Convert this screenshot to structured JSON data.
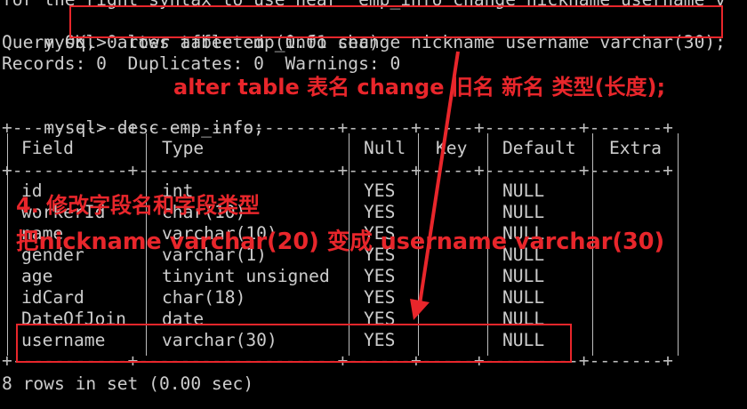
{
  "terminal": {
    "line0": "for the right syntax to use near 'emp_info change nickname username v",
    "prompt": "mysql>",
    "cmd1": "alter table emp_info change nickname username varchar(30);",
    "query_ok": "Query OK, 0 rows affected (0.01 sec)",
    "records": "Records: 0  Duplicates: 0  Warnings: 0",
    "cmd2": "desc emp_info;",
    "border": "+-----------+-------------------+------+-----+---------+-------+",
    "headers": [
      "Field",
      "Type",
      "Null",
      "Key",
      "Default",
      "Extra"
    ],
    "rows": [
      {
        "field": "id",
        "type": "int",
        "null": "YES",
        "key": "",
        "default": "NULL",
        "extra": ""
      },
      {
        "field": "workerId",
        "type": "char(10)",
        "null": "YES",
        "key": "",
        "default": "NULL",
        "extra": ""
      },
      {
        "field": "name",
        "type": "varchar(10)",
        "null": "YES",
        "key": "",
        "default": "NULL",
        "extra": ""
      },
      {
        "field": "gender",
        "type": "varchar(1)",
        "null": "YES",
        "key": "",
        "default": "NULL",
        "extra": ""
      },
      {
        "field": "age",
        "type": "tinyint unsigned",
        "null": "YES",
        "key": "",
        "default": "NULL",
        "extra": ""
      },
      {
        "field": "idCard",
        "type": "char(18)",
        "null": "YES",
        "key": "",
        "default": "NULL",
        "extra": ""
      },
      {
        "field": "DateOfJoin",
        "type": "date",
        "null": "YES",
        "key": "",
        "default": "NULL",
        "extra": ""
      },
      {
        "field": "username",
        "type": "varchar(30)",
        "null": "YES",
        "key": "",
        "default": "NULL",
        "extra": ""
      }
    ],
    "footer": "8 rows in set (0.00 sec)"
  },
  "annotations": {
    "syntax": "alter table 表名 change 旧名 新名 类型(长度);",
    "step": "4. 修改字段名和字段类型",
    "description": "把nickname varchar(20) 变成 username varchar(30)"
  },
  "colors": {
    "accent": "#e8262b",
    "text": "#cccccc",
    "background": "#000000"
  }
}
